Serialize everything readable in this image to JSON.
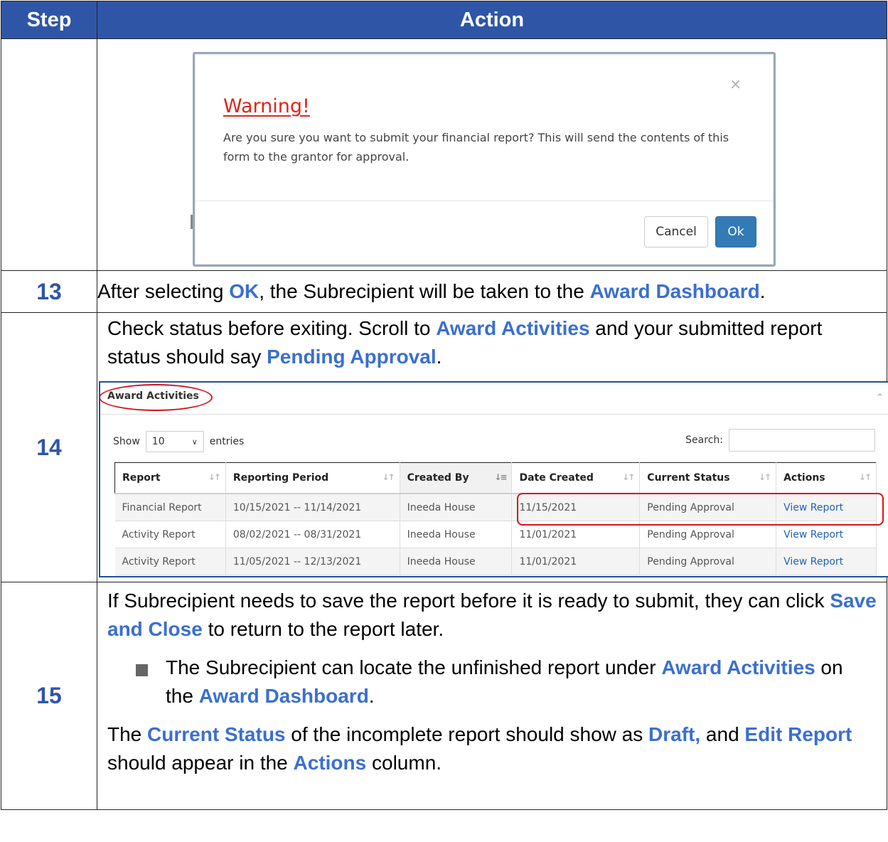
{
  "header": {
    "step": "Step",
    "action": "Action"
  },
  "modal": {
    "close_glyph": "×",
    "title": "Warning!",
    "body": "Are you sure you want to submit your financial report? This will send the contents of this form to the grantor for approval.",
    "cancel_label": "Cancel",
    "ok_label": "Ok"
  },
  "step13": {
    "number": "13",
    "t1": "After selecting ",
    "h1": "OK",
    "t2": ", the Subrecipient will be taken to the ",
    "h2": "Award Dashboard",
    "t3": "."
  },
  "step14": {
    "number": "14",
    "t1": "Check status before exiting. Scroll to ",
    "h1": "Award Activities",
    "t2": " and your submitted report status should say ",
    "h2": "Pending Approval",
    "t3": "."
  },
  "activities": {
    "title": "Award Activities",
    "show_label": "Show",
    "entries_value": "10",
    "entries_label": "entries",
    "search_label": "Search:",
    "columns": [
      "Report",
      "Reporting Period",
      "Created By",
      "Date Created",
      "Current Status",
      "Actions"
    ],
    "rows": [
      [
        "Financial Report",
        "10/15/2021 -- 11/14/2021",
        "Ineeda House",
        "11/15/2021",
        "Pending Approval",
        "View Report"
      ],
      [
        "Activity Report",
        "08/02/2021 -- 08/31/2021",
        "Ineeda House",
        "11/01/2021",
        "Pending Approval",
        "View Report"
      ],
      [
        "Activity Report",
        "11/05/2021 -- 12/13/2021",
        "Ineeda House",
        "11/01/2021",
        "Pending Approval",
        "View Report"
      ]
    ]
  },
  "step15": {
    "number": "15",
    "p1_t1": "If Subrecipient needs to save the report before it is ready to submit, they can click ",
    "p1_h1": "Save and Close",
    "p1_t2": " to return to the report later.",
    "b_t1": "The Subrecipient can locate the unfinished report under ",
    "b_h1": "Award Activities",
    "b_t2": " on the ",
    "b_h2": "Award Dashboard",
    "b_t3": ".",
    "p2_t1": "The ",
    "p2_h1": "Current Status",
    "p2_t2": " of the incomplete report should show as ",
    "p2_h2": "Draft,",
    "p2_t3": " and ",
    "p2_h3": "Edit Report",
    "p2_t4": " should appear in the ",
    "p2_h4": "Actions",
    "p2_t5": " column."
  },
  "colors": {
    "header_bg": "#2f56a6",
    "highlight": "#3a6fd0",
    "warning": "#e1251b",
    "ok_button": "#337ab7",
    "annotation": "#d4131b"
  }
}
